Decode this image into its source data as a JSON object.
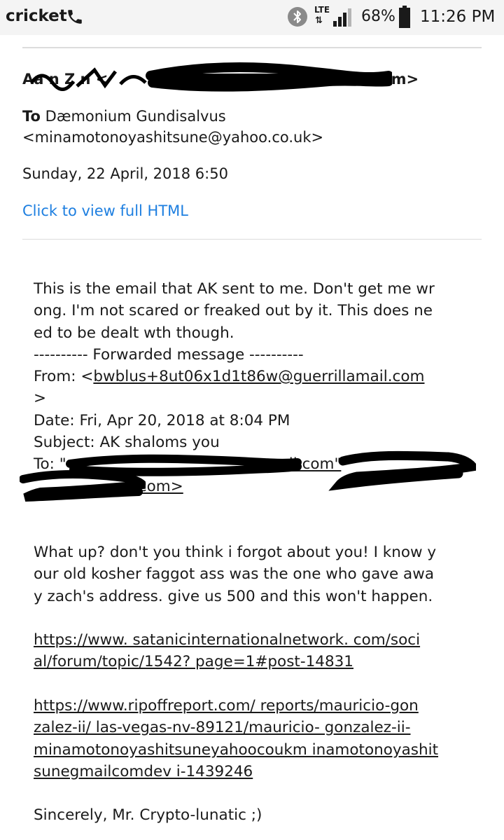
{
  "status_bar": {
    "carrier": "cricket",
    "network": "LTE",
    "network_arrows": "⇅",
    "battery": "68%",
    "time": "11:26 PM",
    "icons": [
      "phone-icon",
      "bluetooth-icon",
      "lte-icon",
      "signal-icon",
      "battery-icon"
    ]
  },
  "email": {
    "from_visible": "Aa   n Z      n <",
    "from_visible_tail": "il.com>",
    "to_label": "To",
    "to_name": "Dæmonium Gundisalvus",
    "to_address": "<minamotonoyashitsune@yahoo.co.uk>",
    "date": "Sunday, 22 April, 2018 6:50",
    "view_full_html": "Click to view full HTML",
    "link_color": "#1e7fe0",
    "body": {
      "line1": "This is the email that AK sent to me. Don't get me wr",
      "line2": "ong. I'm not scared or freaked out by it. This does ne",
      "line3": "ed to be dealt wth though.",
      "fwd_header": "---------- Forwarded message ----------",
      "fwd_from_label": "From: <",
      "fwd_from_address": "bwblus+8ut06x1d1t86w@guerrillamail.com",
      "fwd_from_close": ">",
      "fwd_date": "Date: Fri, Apr 20, 2018 at 8:04 PM",
      "fwd_subject": "Subject: AK shaloms you",
      "fwd_to_label": "To: \"",
      "fwd_to_visible": "ail.com\"",
      "fwd_to_line2_visible": "l.com>",
      "msg_line1": "What up? don't you think i forgot about you! I know y",
      "msg_line2": "our old kosher faggot ass was the one who gave awa",
      "msg_line3": "y zach's address. give us 500 and this won't happen.",
      "url1_line1": "https://www. satanicinternationalnetwork. com/soci",
      "url1_line2": "al/forum/topic/1542? page=1#post-14831",
      "url2_line1": "https://www.ripoffreport.com/ reports/mauricio-gon",
      "url2_line2": "zalez-ii/ las-vegas-nv-89121/mauricio- gonzalez-ii-",
      "url2_line3": "minamotonoyashitsuneyahoocoukm inamotonoyashit",
      "url2_line4": "sunegmailcomdev i-1439246",
      "signoff": "Sincerely, Mr. Crypto-lunatic ;)"
    }
  }
}
